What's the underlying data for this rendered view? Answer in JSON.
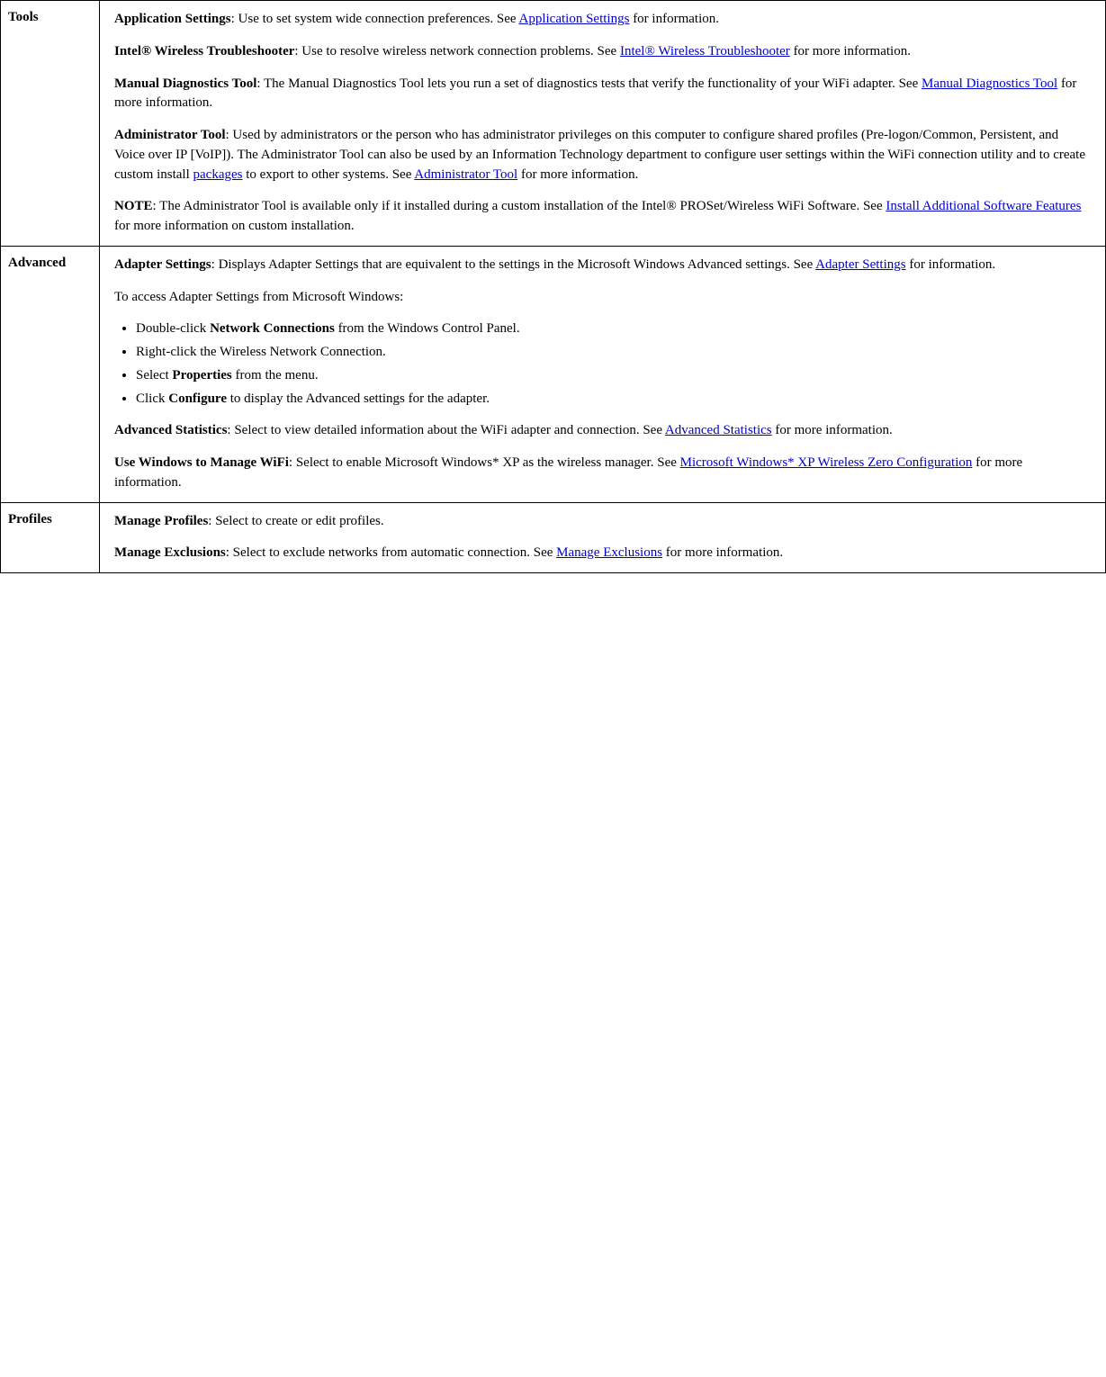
{
  "sections": [
    {
      "label": "Tools",
      "paragraphs": [
        {
          "id": "tools-app-settings",
          "html": "<strong>Application Settings</strong>: Use to set system wide connection preferences. See <a href='#'>Application Settings</a> for information."
        },
        {
          "id": "tools-wireless-troubleshooter",
          "html": "<strong>Intel® Wireless Troubleshooter</strong>: Use to resolve wireless network connection problems. See <a href='#'>Intel® Wireless Troubleshooter</a> for more information."
        },
        {
          "id": "tools-manual-diagnostics",
          "html": "<strong>Manual Diagnostics Tool</strong>: The Manual Diagnostics Tool lets you run a set of diagnostics tests that verify the functionality of your WiFi adapter. See <a href='#'>Manual Diagnostics Tool</a> for more information."
        },
        {
          "id": "tools-administrator",
          "html": "<strong>Administrator Tool</strong>: Used by administrators or the person who has administrator privileges on this computer to configure shared profiles (Pre-logon/Common, Persistent, and Voice over IP [VoIP]). The Administrator Tool can also be used by an Information Technology department to configure user settings within the WiFi connection utility and to create custom install <a href='#'>packages</a> to export to other systems. See <a href='#'>Administrator Tool</a> for more information."
        },
        {
          "id": "tools-note",
          "html": "<strong>NOTE</strong>: The Administrator Tool is available only if it installed during a custom installation of the Intel® PROSet/Wireless WiFi Software. See <a href='#'>Install Additional Software Features</a> for more information on custom installation."
        }
      ]
    },
    {
      "label": "Advanced",
      "paragraphs": [
        {
          "id": "advanced-adapter-settings",
          "html": "<strong>Adapter Settings</strong>: Displays Adapter Settings that are equivalent to the settings in the Microsoft Windows Advanced settings. See <a href='#'>Adapter Settings</a> for information."
        },
        {
          "id": "advanced-adapter-from-windows",
          "html": "To access Adapter Settings from Microsoft Windows:"
        },
        {
          "id": "advanced-list",
          "type": "list",
          "items": [
            "Double-click <strong>Network Connections</strong> from the Windows Control Panel.",
            "Right-click the Wireless Network Connection.",
            "Select <strong>Properties</strong> from the menu.",
            "Click <strong>Configure</strong> to display the Advanced settings for the adapter."
          ]
        },
        {
          "id": "advanced-statistics",
          "html": "<strong>Advanced Statistics</strong>: Select to view detailed information about the WiFi adapter and connection. See <a href='#'>Advanced Statistics</a> for more information."
        },
        {
          "id": "advanced-windows-manage",
          "html": "<strong>Use Windows to Manage WiFi</strong>: Select to enable Microsoft Windows* XP as the wireless manager. See <a href='#'>Microsoft Windows* XP Wireless Zero Configuration</a> for more information."
        }
      ]
    },
    {
      "label": "Profiles",
      "paragraphs": [
        {
          "id": "profiles-manage",
          "html": "<strong>Manage Profiles</strong>: Select to create or edit profiles."
        },
        {
          "id": "profiles-exclusions",
          "html": "<strong>Manage Exclusions</strong>: Select to exclude networks from automatic connection. See <a href='#'>Manage Exclusions</a> for more information."
        }
      ]
    }
  ]
}
